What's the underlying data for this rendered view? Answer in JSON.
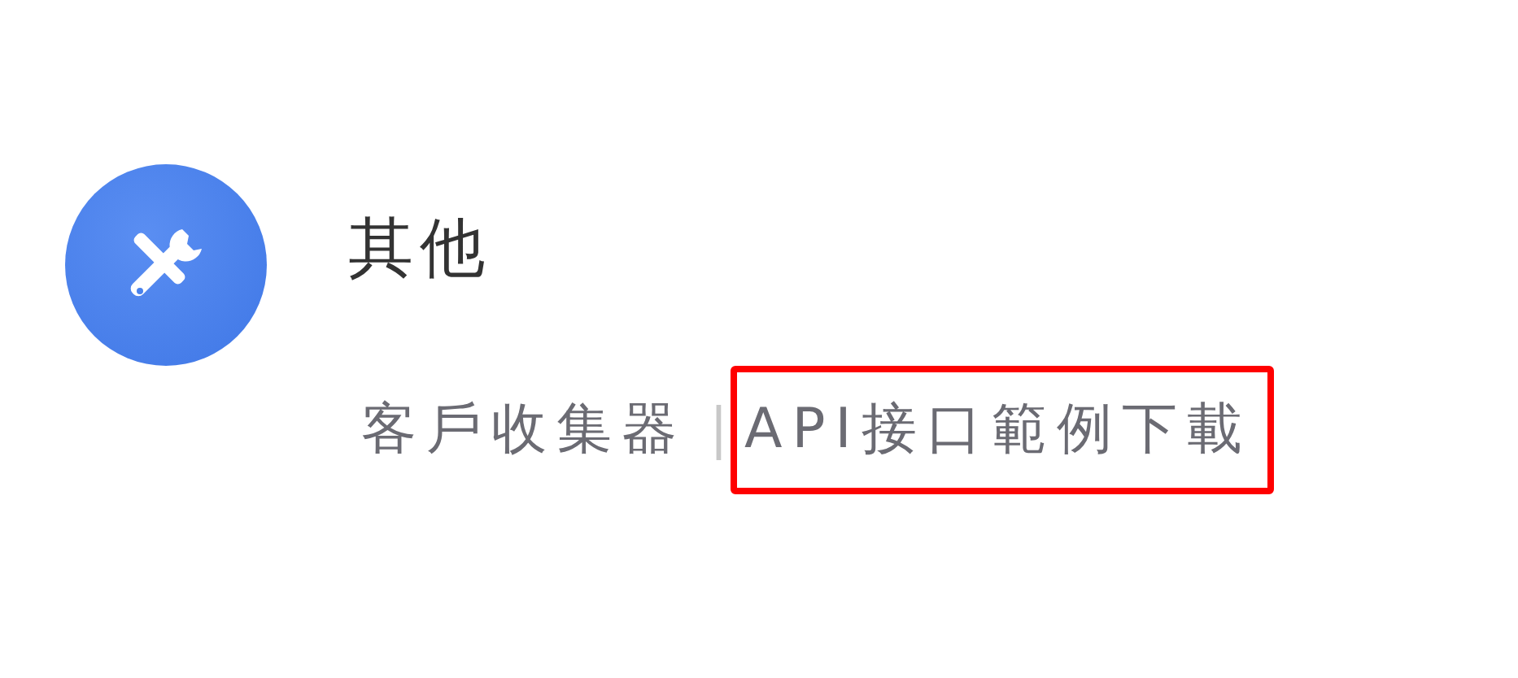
{
  "section": {
    "title": "其他",
    "links": [
      {
        "label": "客戶收集器",
        "highlighted": false
      },
      {
        "label": "API接口範例下載",
        "highlighted": true
      }
    ],
    "separators": [
      "|"
    ]
  }
}
